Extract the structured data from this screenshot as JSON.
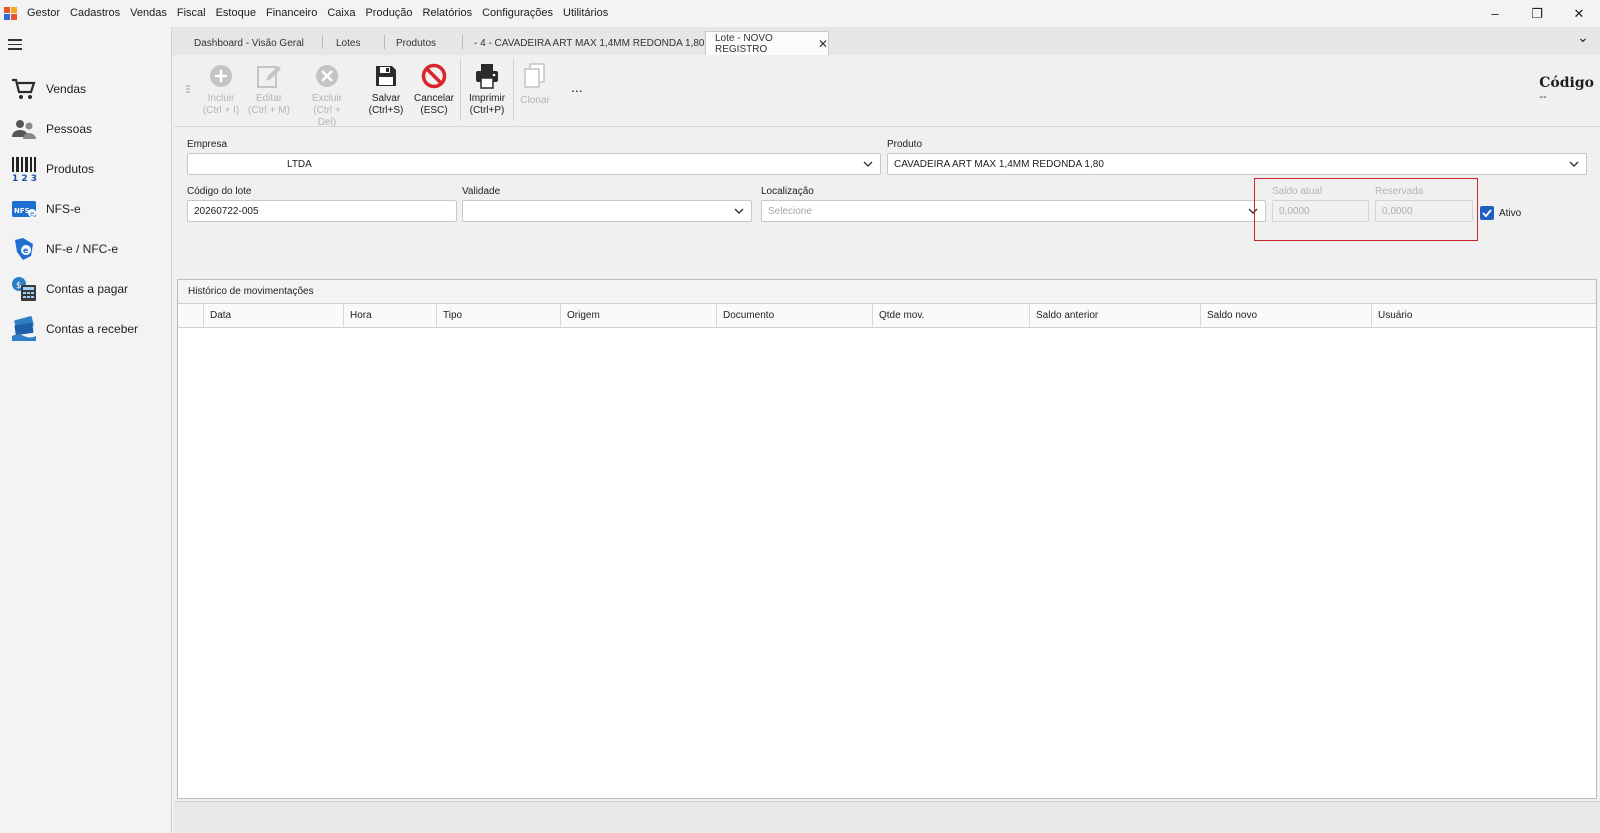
{
  "menu": [
    "Gestor",
    "Cadastros",
    "Vendas",
    "Fiscal",
    "Estoque",
    "Financeiro",
    "Caixa",
    "Produção",
    "Relatórios",
    "Configurações",
    "Utilitários"
  ],
  "window_controls": {
    "minimize": "–",
    "restore": "❐",
    "close": "✕"
  },
  "sidebar": {
    "items": [
      {
        "label": "Vendas",
        "icon": "cart-icon"
      },
      {
        "label": "Pessoas",
        "icon": "people-icon"
      },
      {
        "label": "Produtos",
        "icon": "barcode-icon"
      },
      {
        "label": "NFS-e",
        "icon": "nfse-icon"
      },
      {
        "label": "NF-e / NFC-e",
        "icon": "nfe-icon"
      },
      {
        "label": "Contas a pagar",
        "icon": "calculator-icon"
      },
      {
        "label": "Contas a receber",
        "icon": "cash-icon"
      }
    ]
  },
  "tabs": [
    {
      "label": "Dashboard - Visão Geral"
    },
    {
      "label": "Lotes"
    },
    {
      "label": "Produtos"
    },
    {
      "label": "- 4 - CAVADEIRA ART MAX 1,4MM REDONDA 1,80"
    },
    {
      "label": "Lote - NOVO REGISTRO",
      "active": true,
      "close": "✕"
    }
  ],
  "tab_overflow": "⌄",
  "toolbar": {
    "incluir": {
      "label": "Incluir",
      "shortcut": "(Ctrl + I)"
    },
    "editar": {
      "label": "Editar",
      "shortcut": "(Ctrl + M)"
    },
    "excluir": {
      "label": "Excluir",
      "shortcut": "(Ctrl + Del)"
    },
    "salvar": {
      "label": "Salvar",
      "shortcut": "(Ctrl+S)"
    },
    "cancelar": {
      "label": "Cancelar",
      "shortcut": "(ESC)"
    },
    "imprimir": {
      "label": "Imprimir",
      "shortcut": "(Ctrl+P)"
    },
    "clonar": {
      "label": "Clonar"
    },
    "more": "..."
  },
  "codigo": {
    "title": "Código",
    "value": "--"
  },
  "form": {
    "empresa": {
      "label": "Empresa",
      "value": "LTDA"
    },
    "produto": {
      "label": "Produto",
      "value": "CAVADEIRA ART MAX 1,4MM REDONDA 1,80"
    },
    "codigo_lote": {
      "label": "Código do lote",
      "value": "20260722-005"
    },
    "validade": {
      "label": "Validade",
      "value": ""
    },
    "localizacao": {
      "label": "Localização",
      "placeholder": "Selecione"
    },
    "saldo_atual": {
      "label": "Saldo atual",
      "value": "0,0000"
    },
    "reservada": {
      "label": "Reservada",
      "value": "0,0000"
    },
    "ativo": {
      "label": "Ativo",
      "checked": true
    }
  },
  "historico": {
    "title": "Histórico de movimentações",
    "columns": [
      "Data",
      "Hora",
      "Tipo",
      "Origem",
      "Documento",
      "Qtde mov.",
      "Saldo anterior",
      "Saldo novo",
      "Usuário"
    ]
  },
  "colors": {
    "accent": "#1f5fbf",
    "cancel": "#d9262e",
    "highlight": "#c8252c"
  }
}
